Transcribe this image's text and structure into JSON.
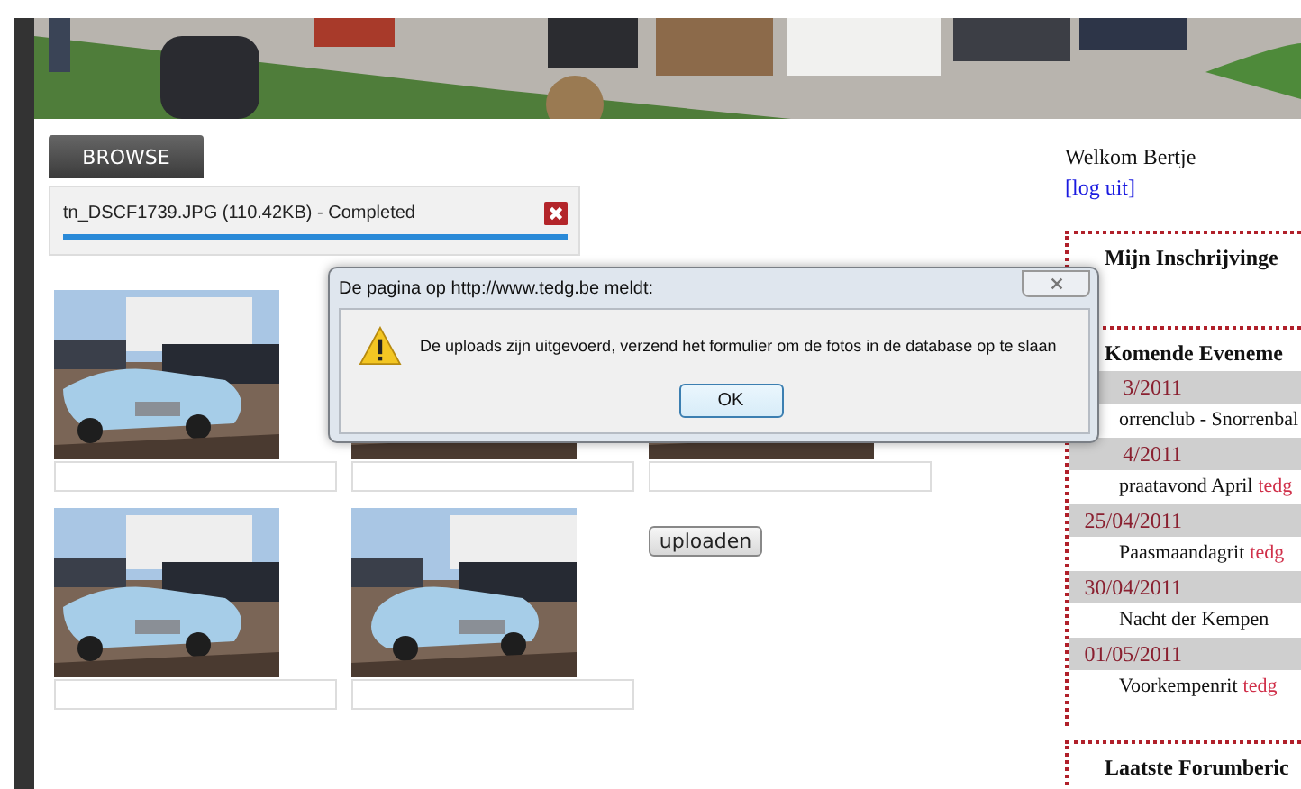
{
  "browse_button": "BROWSE",
  "upload": {
    "file": "tn_DSCF1739.JPG (110.42KB) - Completed",
    "level": 1
  },
  "upload_button": "uploaden",
  "dialog": {
    "title": "De pagina op http://www.tedg.be meldt:",
    "message": "De uploads zijn uitgevoerd, verzend het formulier om de fotos in de database op te slaan",
    "ok": "OK"
  },
  "sidebar": {
    "welcome": "Welkom Bertje",
    "logout": "[log uit]",
    "registrations_title": "Mijn Inschrijvinge",
    "events_title": "Komende Eveneme",
    "events": [
      {
        "date": "3/2011",
        "title": "orrenclub - Snorrenbal"
      },
      {
        "date": "4/2011",
        "title": "praatavond April",
        "tag": "tedg"
      },
      {
        "date": "25/04/2011",
        "title": "Paasmaandagrit",
        "tag": "tedg"
      },
      {
        "date": "30/04/2011",
        "title": "Nacht der Kempen"
      },
      {
        "date": "01/05/2011",
        "title": "Voorkempenrit",
        "tag": "tedg"
      }
    ],
    "forum_title": "Laatste Forumberic"
  }
}
